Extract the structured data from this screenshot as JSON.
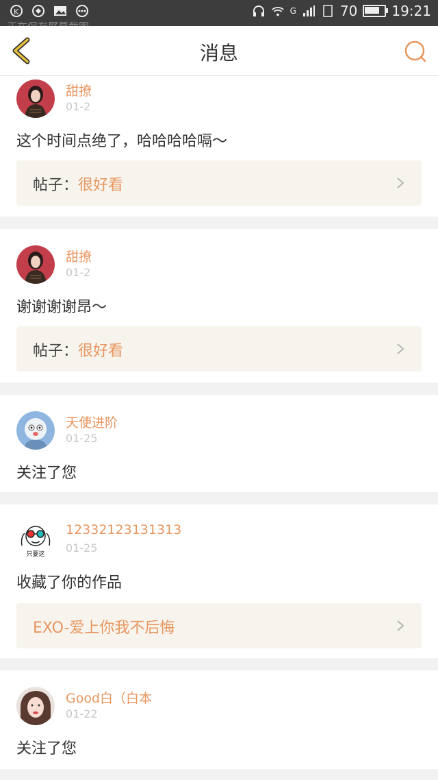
{
  "status_bar": {
    "notice": "正在保存屏幕截图",
    "battery": "70",
    "time": "19:21",
    "network": "G"
  },
  "nav": {
    "title": "消息"
  },
  "items": [
    {
      "user": "甜撩",
      "date": "01-2",
      "message": "这个时间点绝了，哈哈哈哈嗝～",
      "ref_prefix": "帖子：",
      "ref_value": "很好看"
    },
    {
      "user": "甜撩",
      "date": "01-2",
      "message": "谢谢谢谢昂～",
      "ref_prefix": "帖子：",
      "ref_value": "很好看"
    },
    {
      "user": "天使进阶",
      "date": "01-25",
      "message": "关注了您"
    },
    {
      "user": "12332123131313",
      "date": "01-25",
      "message": "收藏了你的作品",
      "ref_value": "EXO-爱上你我不后悔",
      "avatar_caption": "只要这"
    },
    {
      "user": "Good白（白本",
      "date": "01-22",
      "message": "关注了您"
    }
  ],
  "colors": {
    "accent": "#e8965f",
    "back_arrow": "#e8c23a",
    "ref_bg": "#f6f4ed"
  }
}
